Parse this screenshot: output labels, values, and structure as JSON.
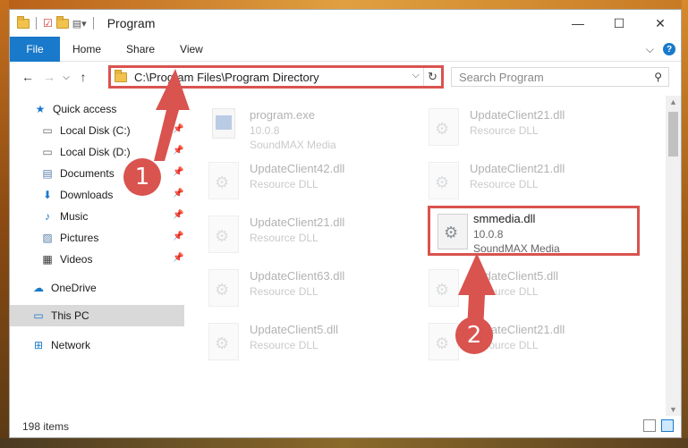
{
  "window": {
    "title": "Program"
  },
  "ribbon": {
    "tabs": [
      "File",
      "Home",
      "Share",
      "View"
    ]
  },
  "address": {
    "path": "C:\\Program Files\\Program Directory"
  },
  "search": {
    "placeholder": "Search Program"
  },
  "sidebar": {
    "quick_access": "Quick access",
    "items": [
      {
        "label": "Local Disk (C:)",
        "icon": "drive-icon"
      },
      {
        "label": "Local Disk (D:)",
        "icon": "drive-icon"
      },
      {
        "label": "Documents",
        "icon": "documents-icon"
      },
      {
        "label": "Downloads",
        "icon": "downloads-icon"
      },
      {
        "label": "Music",
        "icon": "music-icon"
      },
      {
        "label": "Pictures",
        "icon": "pictures-icon"
      },
      {
        "label": "Videos",
        "icon": "videos-icon"
      }
    ],
    "onedrive": "OneDrive",
    "this_pc": "This PC",
    "network": "Network"
  },
  "files": [
    {
      "name": "program.exe",
      "version": "10.0.8",
      "desc": "SoundMAX Media"
    },
    {
      "name": "UpdateClient21.dll",
      "version": "",
      "desc": "Resource DLL"
    },
    {
      "name": "UpdateClient42.dll",
      "version": "",
      "desc": "Resource DLL"
    },
    {
      "name": "UpdateClient21.dll",
      "version": "",
      "desc": "Resource DLL"
    },
    {
      "name": "UpdateClient21.dll",
      "version": "",
      "desc": "Resource DLL"
    },
    {
      "name": "smmedia.dll",
      "version": "10.0.8",
      "desc": "SoundMAX Media"
    },
    {
      "name": "UpdateClient63.dll",
      "version": "",
      "desc": "Resource DLL"
    },
    {
      "name": "UpdateClient5.dll",
      "version": "",
      "desc": "Resource DLL"
    },
    {
      "name": "UpdateClient5.dll",
      "version": "",
      "desc": "Resource DLL"
    },
    {
      "name": "UpdateClient21.dll",
      "version": "",
      "desc": "Resource DLL"
    }
  ],
  "status": {
    "count": "198 items"
  },
  "markers": {
    "one": "1",
    "two": "2"
  },
  "colors": {
    "accent": "#1979ca",
    "highlight": "#d9534f",
    "selection": "#d9d9d9"
  }
}
